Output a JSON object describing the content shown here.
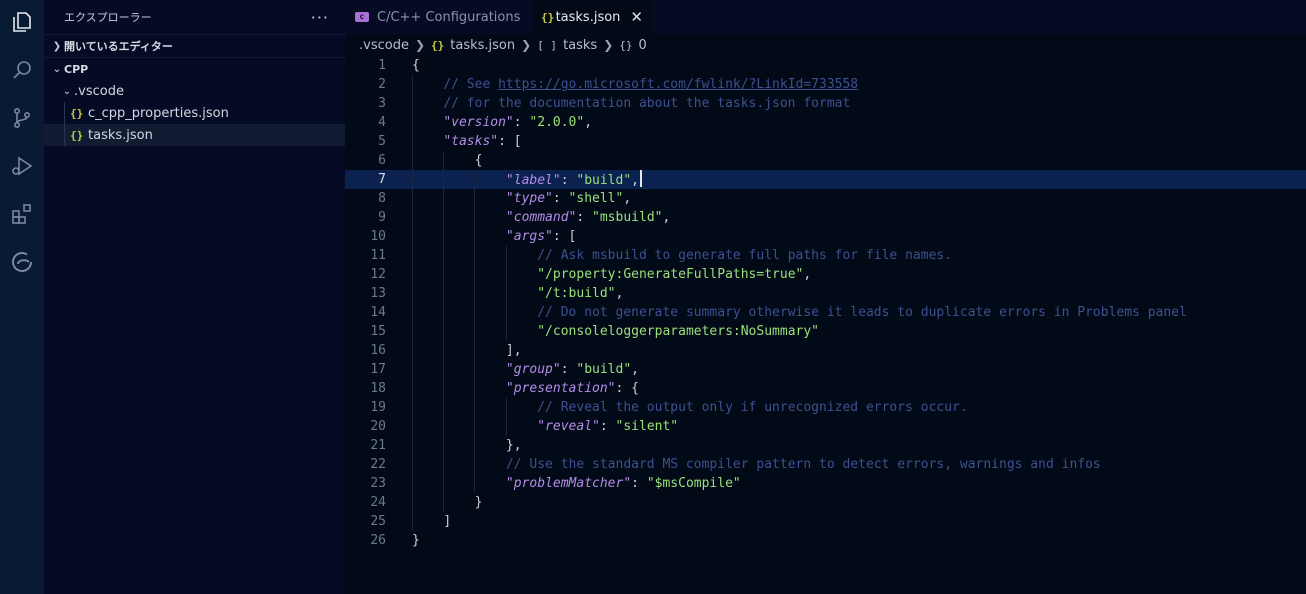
{
  "explorer": {
    "title": "エクスプローラー",
    "more": "···",
    "open_editors_label": "開いているエディター",
    "folder_label": "CPP",
    "subfolder_label": ".vscode",
    "files": [
      {
        "icon": "{}",
        "name": "c_cpp_properties.json"
      },
      {
        "icon": "{}",
        "name": "tasks.json"
      }
    ]
  },
  "tabs": [
    {
      "label": "C/C++ Configurations",
      "icon": "c-cpp-config-icon"
    },
    {
      "label": "tasks.json",
      "icon": "{}",
      "close": "✕"
    }
  ],
  "breadcrumb": {
    "folder": ".vscode",
    "file_icon": "{}",
    "file": "tasks.json",
    "array_icon": "[ ]",
    "array": "tasks",
    "object_icon": "{}",
    "object": "0"
  },
  "editor": {
    "current_line": 7,
    "lines": [
      "{",
      "    // See https://go.microsoft.com/fwlink/?LinkId=733558",
      "    // for the documentation about the tasks.json format",
      "    \"version\": \"2.0.0\",",
      "    \"tasks\": [",
      "        {",
      "            \"label\": \"build\",",
      "            \"type\": \"shell\",",
      "            \"command\": \"msbuild\",",
      "            \"args\": [",
      "                // Ask msbuild to generate full paths for file names.",
      "                \"/property:GenerateFullPaths=true\",",
      "                \"/t:build\",",
      "                // Do not generate summary otherwise it leads to duplicate errors in Problems panel",
      "                \"/consoleloggerparameters:NoSummary\"",
      "            ],",
      "            \"group\": \"build\",",
      "            \"presentation\": {",
      "                // Reveal the output only if unrecognized errors occur.",
      "                \"reveal\": \"silent\"",
      "            },",
      "            // Use the standard MS compiler pattern to detect errors, warnings and infos",
      "            \"problemMatcher\": \"$msCompile\"",
      "        }",
      "    ]",
      "}"
    ]
  },
  "colors": {
    "background": "#020a17",
    "activity_bar": "#091a33",
    "sidebar": "#050b24",
    "comment": "#3f4f8f",
    "key": "#b48ce8",
    "string": "#9be07a",
    "current_line": "#0b2150"
  }
}
